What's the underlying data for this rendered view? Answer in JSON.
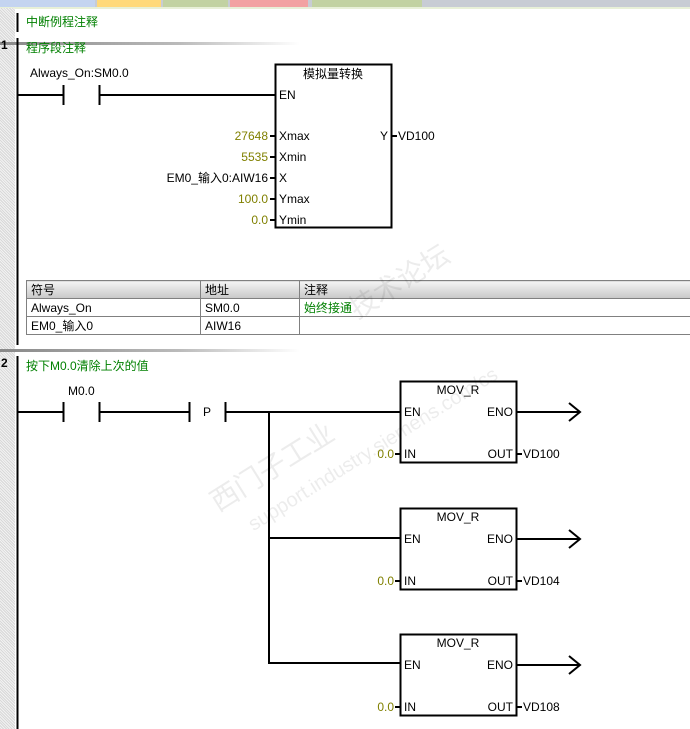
{
  "tabs": [
    {
      "color": "#c4d4f0"
    },
    {
      "color": "#ffd97a"
    },
    {
      "color": "#c2d2a2"
    },
    {
      "color": "#f2a2a2"
    },
    {
      "color": "#c2d2a2"
    }
  ],
  "block_comment": "中断例程注释",
  "networks": [
    {
      "number": "1",
      "comment": "程序段注释",
      "contact_label": "Always_On:SM0.0",
      "box": {
        "title": "模拟量转换",
        "en": "EN",
        "inputs": [
          {
            "pin": "Xmax",
            "value": "27648"
          },
          {
            "pin": "Xmin",
            "value": "5535"
          },
          {
            "pin": "X",
            "value": "EM0_输入0:AIW16"
          },
          {
            "pin": "Ymax",
            "value": "100.0"
          },
          {
            "pin": "Ymin",
            "value": "0.0"
          }
        ],
        "output_pin": "Y",
        "output_value": "VD100"
      },
      "symbol_table": {
        "headers": [
          "符号",
          "地址",
          "注释"
        ],
        "rows": [
          [
            "Always_On",
            "SM0.0",
            "始终接通"
          ],
          [
            "EM0_输入0",
            "AIW16",
            ""
          ]
        ]
      }
    },
    {
      "number": "2",
      "comment": "按下M0.0清除上次的值",
      "contact_label": "M0.0",
      "edge_label": "P",
      "boxes": [
        {
          "title": "MOV_R",
          "en": "EN",
          "eno": "ENO",
          "in_pin": "IN",
          "in_value": "0.0",
          "out_pin": "OUT",
          "out_value": "VD100"
        },
        {
          "title": "MOV_R",
          "en": "EN",
          "eno": "ENO",
          "in_pin": "IN",
          "in_value": "0.0",
          "out_pin": "OUT",
          "out_value": "VD104"
        },
        {
          "title": "MOV_R",
          "en": "EN",
          "eno": "ENO",
          "in_pin": "IN",
          "in_value": "0.0",
          "out_pin": "OUT",
          "out_value": "VD108"
        }
      ]
    }
  ],
  "watermark": "西门子工业 support.industry.siemens.com/cs 技术论坛"
}
